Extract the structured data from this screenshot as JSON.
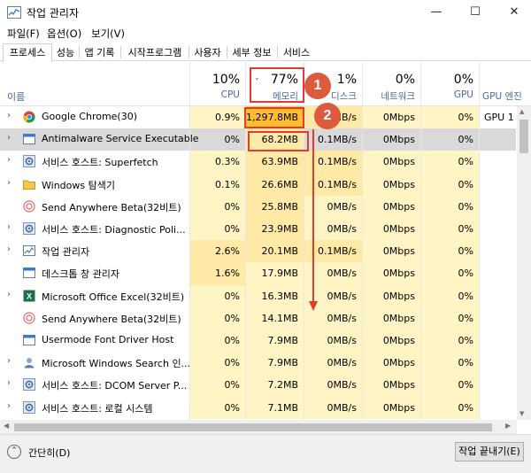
{
  "window": {
    "title": "작업 관리자",
    "minimize_glyph": "—",
    "maximize_glyph": "☐",
    "close_glyph": "✕"
  },
  "menu": [
    "파일(F)",
    "옵션(O)",
    "보기(V)"
  ],
  "tabs": [
    {
      "label": "프로세스",
      "active": true
    },
    {
      "label": "성능"
    },
    {
      "label": "앱 기록"
    },
    {
      "label": "시작프로그램"
    },
    {
      "label": "사용자"
    },
    {
      "label": "세부 정보"
    },
    {
      "label": "서비스"
    }
  ],
  "columns": {
    "name": {
      "label": "이름"
    },
    "cpu": {
      "percent": "10%",
      "label": "CPU"
    },
    "memory": {
      "percent": "77%",
      "label": "메모리",
      "sort": "descending"
    },
    "disk": {
      "percent": "1%",
      "label": "디스크"
    },
    "network": {
      "percent": "0%",
      "label": "네트워크"
    },
    "gpu": {
      "percent": "0%",
      "label": "GPU"
    },
    "gpu_engine": {
      "label": "GPU 엔진"
    }
  },
  "processes": [
    {
      "name": "Google Chrome(30)",
      "icon": "chrome-icon",
      "expandable": true,
      "cpu": "0.9%",
      "memory": "1,297.8MB",
      "disk": "0.1MB/s",
      "network": "0Mbps",
      "gpu": "0%",
      "gpu_engine": "GPU 1 -"
    },
    {
      "name": "Antimalware Service Executable",
      "icon": "antimalware-icon",
      "expandable": true,
      "selected": true,
      "cpu": "0%",
      "memory": "68.2MB",
      "disk": "0.1MB/s",
      "network": "0Mbps",
      "gpu": "0%",
      "gpu_engine": ""
    },
    {
      "name": "서비스 호스트: Superfetch",
      "icon": "service-host-icon",
      "expandable": true,
      "cpu": "0.3%",
      "memory": "63.9MB",
      "disk": "0.1MB/s",
      "network": "0Mbps",
      "gpu": "0%",
      "gpu_engine": ""
    },
    {
      "name": "Windows 탐색기",
      "icon": "folder-icon",
      "expandable": true,
      "cpu": "0.1%",
      "memory": "26.6MB",
      "disk": "0.1MB/s",
      "network": "0Mbps",
      "gpu": "0%",
      "gpu_engine": ""
    },
    {
      "name": "Send Anywhere Beta(32비트)",
      "icon": "send-anywhere-icon",
      "expandable": false,
      "cpu": "0%",
      "memory": "25.8MB",
      "disk": "0MB/s",
      "network": "0Mbps",
      "gpu": "0%",
      "gpu_engine": ""
    },
    {
      "name": "서비스 호스트: Diagnostic Poli...",
      "icon": "service-host-icon",
      "expandable": true,
      "cpu": "0%",
      "memory": "23.9MB",
      "disk": "0MB/s",
      "network": "0Mbps",
      "gpu": "0%",
      "gpu_engine": ""
    },
    {
      "name": "작업 관리자",
      "icon": "task-manager-icon",
      "expandable": true,
      "cpu": "2.6%",
      "memory": "20.1MB",
      "disk": "0.1MB/s",
      "network": "0Mbps",
      "gpu": "0%",
      "gpu_engine": ""
    },
    {
      "name": "데스크톱 창 관리자",
      "icon": "window-icon",
      "expandable": false,
      "cpu": "1.6%",
      "memory": "17.9MB",
      "disk": "0MB/s",
      "network": "0Mbps",
      "gpu": "0%",
      "gpu_engine": ""
    },
    {
      "name": "Microsoft Office Excel(32비트)",
      "icon": "excel-icon",
      "expandable": true,
      "cpu": "0%",
      "memory": "16.3MB",
      "disk": "0MB/s",
      "network": "0Mbps",
      "gpu": "0%",
      "gpu_engine": ""
    },
    {
      "name": "Send Anywhere Beta(32비트)",
      "icon": "send-anywhere-icon",
      "expandable": false,
      "cpu": "0%",
      "memory": "14.1MB",
      "disk": "0MB/s",
      "network": "0Mbps",
      "gpu": "0%",
      "gpu_engine": ""
    },
    {
      "name": "Usermode Font Driver Host",
      "icon": "window-icon",
      "expandable": false,
      "cpu": "0%",
      "memory": "7.9MB",
      "disk": "0MB/s",
      "network": "0Mbps",
      "gpu": "0%",
      "gpu_engine": ""
    },
    {
      "name": "Microsoft Windows Search 인...",
      "icon": "search-user-icon",
      "expandable": true,
      "cpu": "0%",
      "memory": "7.9MB",
      "disk": "0MB/s",
      "network": "0Mbps",
      "gpu": "0%",
      "gpu_engine": ""
    },
    {
      "name": "서비스 호스트: DCOM Server P...",
      "icon": "service-host-icon",
      "expandable": true,
      "cpu": "0%",
      "memory": "7.2MB",
      "disk": "0MB/s",
      "network": "0Mbps",
      "gpu": "0%",
      "gpu_engine": ""
    },
    {
      "name": "서비스 호스트: 로컬 시스템",
      "icon": "service-host-icon",
      "expandable": true,
      "cpu": "0%",
      "memory": "7.1MB",
      "disk": "0MB/s",
      "network": "0Mbps",
      "gpu": "0%",
      "gpu_engine": ""
    }
  ],
  "annotations": [
    {
      "label": "1"
    },
    {
      "label": "2"
    }
  ],
  "footer": {
    "fewer_details_label": "간단히(D)",
    "end_task_label": "작업 끝내기(E)"
  },
  "colors": {
    "cell_light": "#fff4c4",
    "cell_medium": "#ffe9a6",
    "cell_hot": "#ffbe30",
    "annotation_red": "#e03c31",
    "annotation_circle": "#dd5a3c"
  }
}
